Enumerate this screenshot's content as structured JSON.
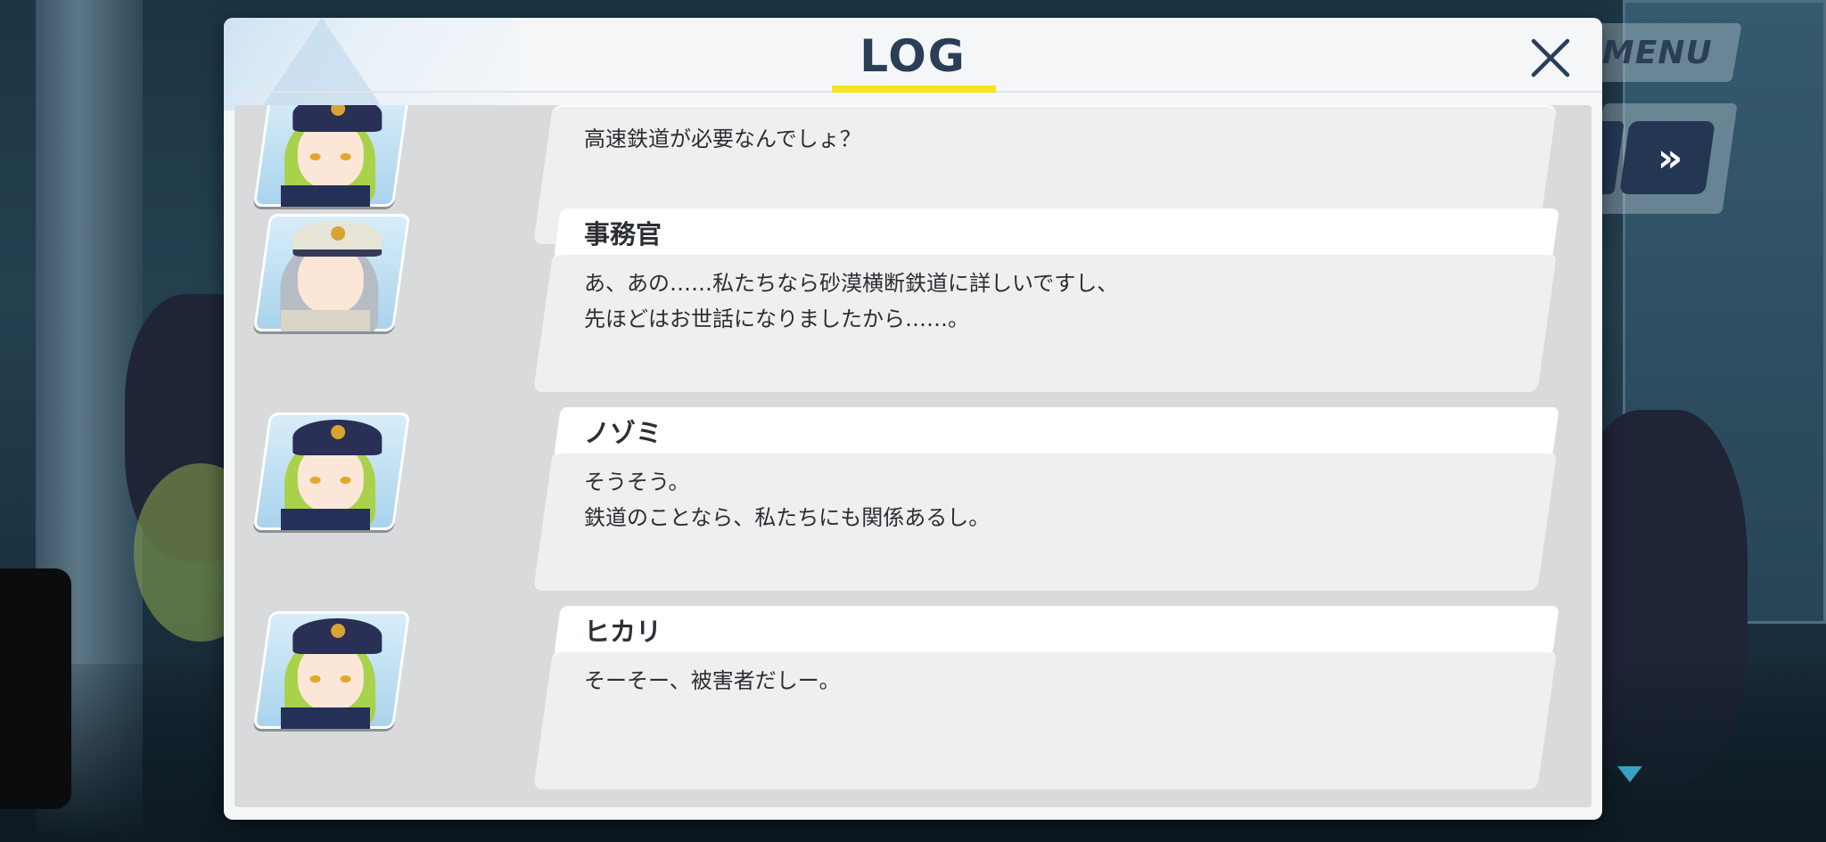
{
  "menu": {
    "label": "MENU"
  },
  "controls": {
    "fast_forward_label": "»"
  },
  "log": {
    "title": "LOG",
    "entries": [
      {
        "speaker": "",
        "line1": "高速鉄道が必要なんでしょ？",
        "line2": "",
        "portrait": "nozomi-portrait"
      },
      {
        "speaker": "事務官",
        "line1": "あ、あの……私たちなら砂漠横断鉄道に詳しいですし、",
        "line2": "先ほどはお世話になりましたから……。",
        "portrait": "clerk-portrait"
      },
      {
        "speaker": "ノゾミ",
        "line1": "そうそう。",
        "line2": "鉄道のことなら、私たちにも関係あるし。",
        "portrait": "nozomi-portrait"
      },
      {
        "speaker": "ヒカリ",
        "line1": "そーそー、被害者だしー。",
        "line2": "",
        "portrait": "hikari-portrait"
      }
    ]
  },
  "colors": {
    "title_underline": "#f5e223",
    "title_text": "#2a3e58",
    "button_navy": "#233752"
  }
}
